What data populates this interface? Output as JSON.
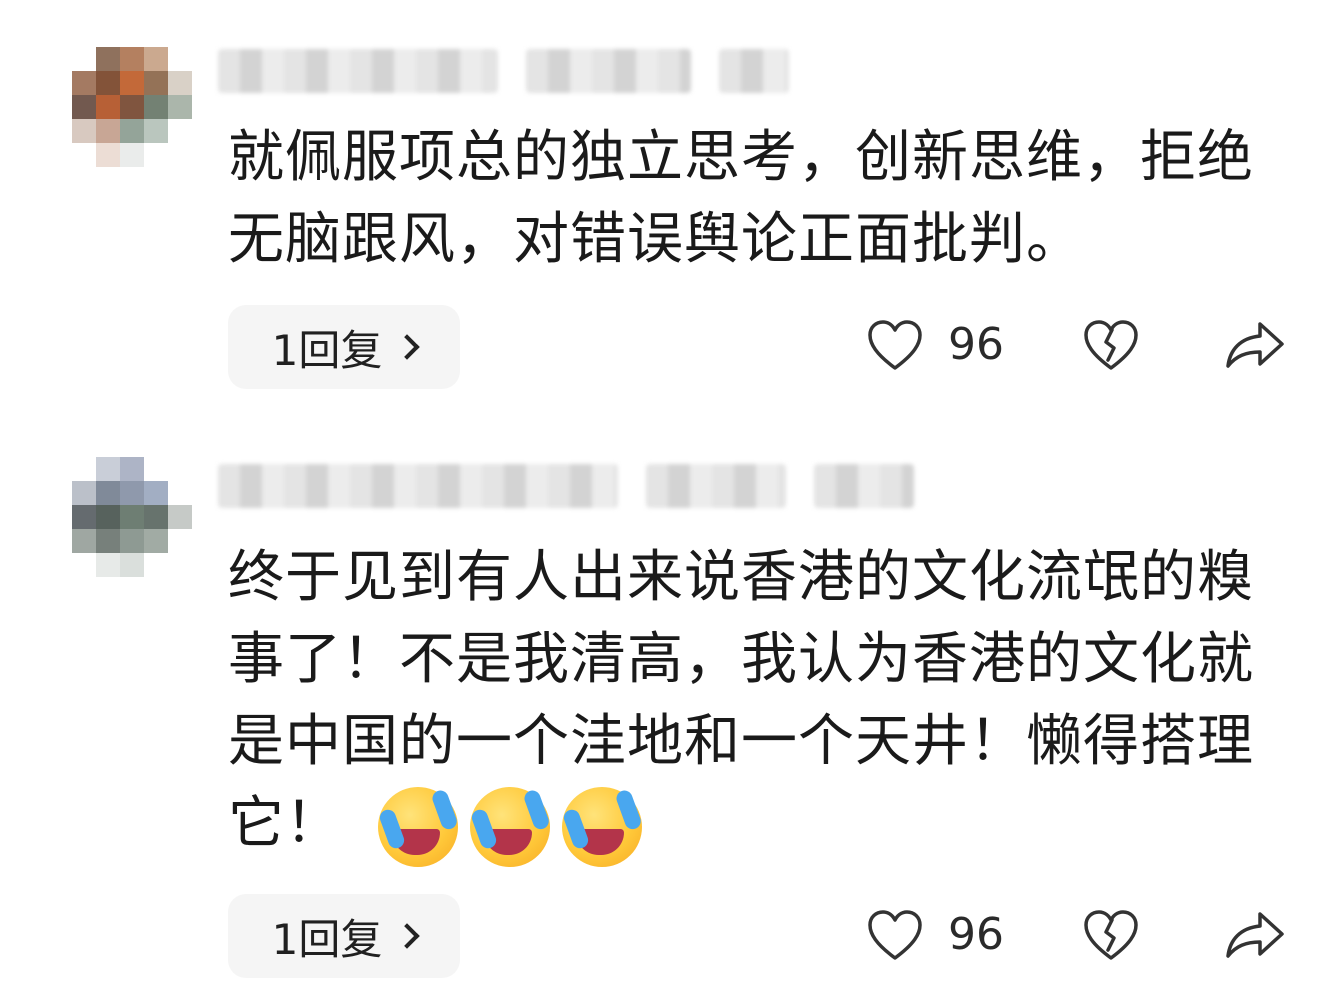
{
  "comments": [
    {
      "text": "就佩服项总的独立思考，创新思维，拒绝无脑跟风，对错误舆论正面批判。",
      "emojis": [],
      "reply_label": "1回复",
      "likes": "96"
    },
    {
      "text": "终于见到有人出来说香港的文化流氓的糗事了！不是我清高，我认为香港的文化就是中国的一个洼地和一个天井！懒得搭理它！",
      "emojis": [
        "crying-laughing-emoji",
        "crying-laughing-emoji",
        "crying-laughing-emoji"
      ],
      "reply_label": "1回复",
      "likes": "96"
    }
  ],
  "icons": {
    "like": "heart-outline-icon",
    "dislike": "broken-heart-icon",
    "share": "share-arrow-icon",
    "reply_chevron": "chevron-right-icon"
  },
  "colors": {
    "background": "#ffffff",
    "text": "#1a1a1a",
    "reply_bg": "#f5f5f5"
  }
}
